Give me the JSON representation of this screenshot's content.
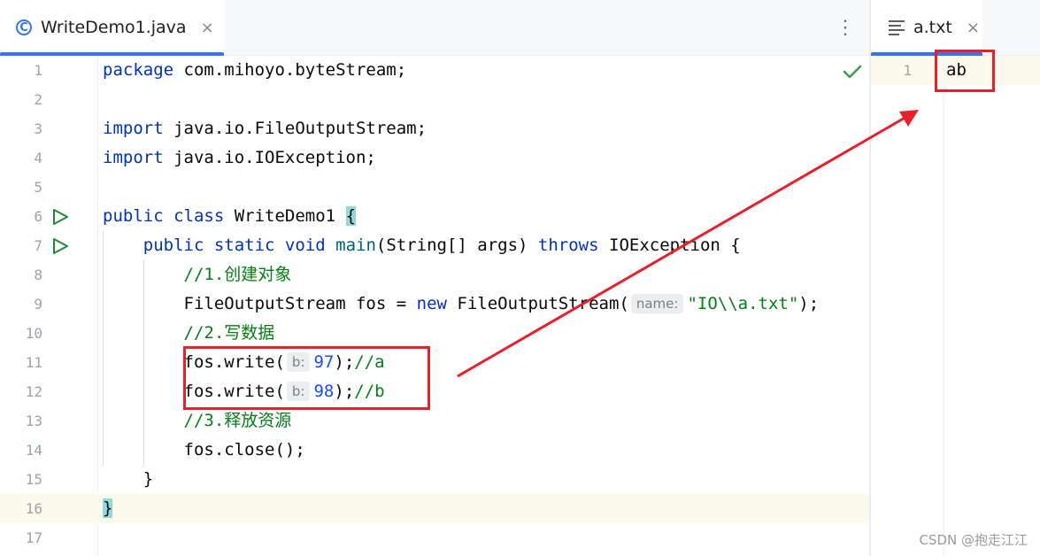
{
  "tabs": {
    "left": {
      "label": "WriteDemo1.java",
      "icon": "java-class-icon",
      "close": "×"
    },
    "right": {
      "label": "a.txt",
      "icon": "text-file-icon",
      "close": "×"
    },
    "more": "⋮"
  },
  "editor": {
    "line_numbers": [
      "1",
      "2",
      "3",
      "4",
      "5",
      "6",
      "7",
      "8",
      "9",
      "10",
      "11",
      "12",
      "13",
      "14",
      "15",
      "16",
      "17"
    ],
    "lines": {
      "l1": {
        "kw": "package",
        "rest": " com.mihoyo.byteStream;"
      },
      "l3": {
        "kw": "import",
        "rest": " java.io.FileOutputStream;"
      },
      "l4": {
        "kw": "import",
        "rest": " java.io.IOException;"
      },
      "l6": {
        "kw1": "public",
        "kw2": " class",
        "name": " WriteDemo1 ",
        "brace": "{"
      },
      "l7": {
        "indent": "    ",
        "kw1": "public",
        "kw2": " static",
        "kw3": " void",
        "fn": " main",
        "args": "(String[] args) ",
        "kw4": "throws",
        "rest": " IOException {"
      },
      "l8": {
        "indent": "        ",
        "comment": "//1.创建对象"
      },
      "l9": {
        "indent": "        ",
        "pre": "FileOutputStream fos = ",
        "kw": "new",
        "ctor": " FileOutputStream(",
        "hint": "name:",
        "str": "\"IO\\\\a.txt\"",
        "end": ");"
      },
      "l10": {
        "indent": "        ",
        "comment": "//2.写数据"
      },
      "l11": {
        "indent": "        ",
        "pre": "fos.write(",
        "hint": "b:",
        "num": "97",
        "end": ");",
        "comment": "//a"
      },
      "l12": {
        "indent": "        ",
        "pre": "fos.write(",
        "hint": "b:",
        "num": "98",
        "end": ");",
        "comment": "//b"
      },
      "l13": {
        "indent": "        ",
        "comment": "//3.释放资源"
      },
      "l14": {
        "indent": "        ",
        "code": "fos.close();"
      },
      "l15": {
        "indent": "    ",
        "code": "}"
      },
      "l16": {
        "brace": "}"
      }
    },
    "current_line": "16",
    "status_icon": "check-icon"
  },
  "right_editor": {
    "line_numbers": [
      "1"
    ],
    "content": "ab"
  },
  "colors": {
    "keyword": "#0033b3",
    "number": "#1750eb",
    "string": "#067d17",
    "annotation": "#e8202a",
    "accent": "#3574f0"
  },
  "watermark": "CSDN @抱走江江"
}
